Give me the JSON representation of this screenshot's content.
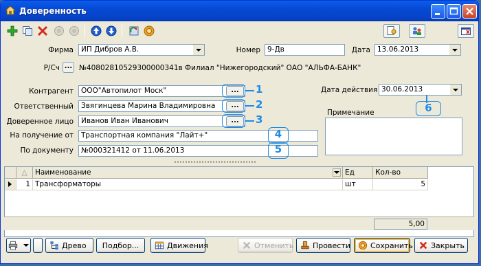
{
  "window": {
    "title": "Доверенность"
  },
  "form": {
    "firma_label": "Фирма",
    "firma_value": "ИП Дибров А.В.",
    "nomer_label": "Номер",
    "nomer_value": "9-Дв",
    "data_label": "Дата",
    "data_value": "13.06.2013",
    "rs_label": "Р/Сч",
    "rs_button": "...",
    "rs_value": "№40802810529300000341в Филиал \"Нижегородский\" ОАО \"АЛЬФА-БАНК\"",
    "kontragent_label": "Контрагент",
    "kontragent_value": "ООО\"Автопилот Моск\"",
    "otvetstvenny_label": "Ответственный",
    "otvetstvenny_value": "Звягинцева Марина Владимировна",
    "doverennoe_label": "Доверенное лицо",
    "doverennoe_value": "Иванов Иван Иванович",
    "poluchenie_label": "На получение от",
    "poluchenie_value": "Транспортная компания \"Лайт+\"",
    "dokument_label": "По документу",
    "dokument_value": "№000321412 от 11.06.2013",
    "data_deistvia_label": "Дата действия",
    "data_deistvia_value": "30.06.2013",
    "primechanie_label": "Примечание",
    "primechanie_value": "",
    "select_button": "..."
  },
  "callouts": {
    "n1": "1",
    "n2": "2",
    "n3": "3",
    "n4": "4",
    "n5": "5",
    "n6": "6"
  },
  "grid": {
    "sort_marker": "△",
    "columns": [
      "Наименование",
      "Ед",
      "Кол-во"
    ],
    "rows": [
      {
        "index": "1",
        "name": "Трансформаторы",
        "unit": "шт",
        "qty": "5"
      }
    ],
    "total": "5,00"
  },
  "buttons": {
    "tree": "Древо",
    "podbor": "Подбор...",
    "dvizhenia": "Движения",
    "otmenit": "Отменить",
    "provesti": "Провести",
    "sohranit": "Сохранить",
    "zakryt": "Закрыть"
  },
  "colors": {
    "titlebar": "#0a5fe7",
    "callout": "#1e8be8",
    "window_bg": "#ece9d8"
  }
}
